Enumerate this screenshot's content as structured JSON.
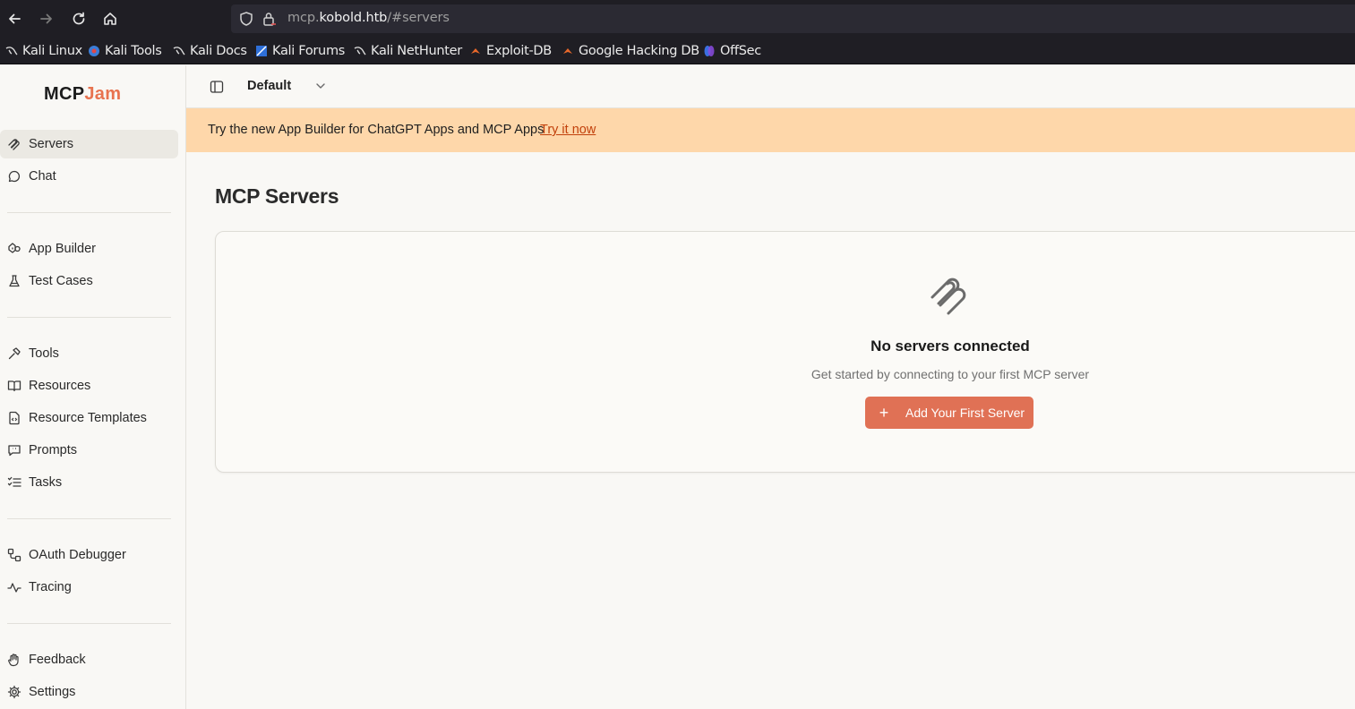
{
  "browser": {
    "url_prefix": "mcp.",
    "url_domain": "kobold.htb",
    "url_path": "/#servers",
    "bookmarks": [
      {
        "label": "Kali Linux",
        "icon": "kali-dragon-icon"
      },
      {
        "label": "Kali Tools",
        "icon": "kali-tools-icon"
      },
      {
        "label": "Kali Docs",
        "icon": "kali-dragon-icon"
      },
      {
        "label": "Kali Forums",
        "icon": "kali-forums-icon"
      },
      {
        "label": "Kali NetHunter",
        "icon": "kali-dragon-icon"
      },
      {
        "label": "Exploit-DB",
        "icon": "exploit-db-icon"
      },
      {
        "label": "Google Hacking DB",
        "icon": "exploit-db-icon"
      },
      {
        "label": "OffSec",
        "icon": "offsec-icon"
      }
    ]
  },
  "app": {
    "logo_part1": "MCP",
    "logo_part2": "Jam",
    "accent_color": "#e07155"
  },
  "sidebar": {
    "items": [
      {
        "label": "Servers",
        "icon": "servers-icon",
        "active": true
      },
      {
        "label": "Chat",
        "icon": "chat-bubble-icon"
      },
      {
        "label": "App Builder",
        "icon": "app-builder-icon"
      },
      {
        "label": "Test Cases",
        "icon": "flask-icon"
      },
      {
        "label": "Tools",
        "icon": "hammer-icon"
      },
      {
        "label": "Resources",
        "icon": "book-icon"
      },
      {
        "label": "Resource Templates",
        "icon": "file-code-icon"
      },
      {
        "label": "Prompts",
        "icon": "message-square-icon"
      },
      {
        "label": "Tasks",
        "icon": "list-checks-icon"
      },
      {
        "label": "OAuth Debugger",
        "icon": "workflow-icon"
      },
      {
        "label": "Tracing",
        "icon": "activity-icon"
      },
      {
        "label": "Feedback",
        "icon": "hand-icon"
      },
      {
        "label": "Settings",
        "icon": "gear-icon"
      }
    ]
  },
  "header": {
    "workspace": "Default"
  },
  "banner": {
    "text": "Try the new App Builder for ChatGPT Apps and MCP Apps",
    "link": "Try it now",
    "color": "#fed7aa"
  },
  "main": {
    "title": "MCP Servers",
    "empty_title": "No servers connected",
    "empty_subtitle": "Get started by connecting to your first MCP server",
    "add_button": "Add Your First Server"
  }
}
